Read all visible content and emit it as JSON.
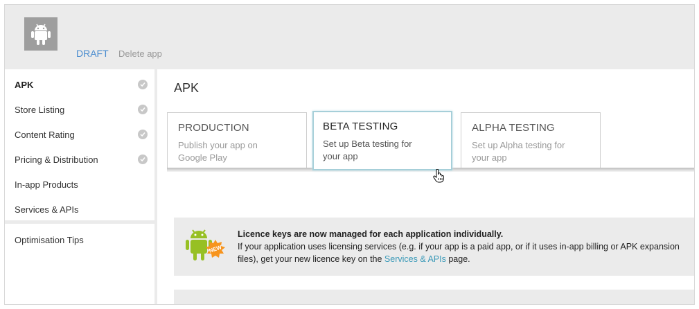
{
  "header": {
    "app_icon": "android-icon",
    "status": "DRAFT",
    "delete_label": "Delete app"
  },
  "sidebar": {
    "items": [
      {
        "label": "APK",
        "active": true,
        "complete": true
      },
      {
        "label": "Store Listing",
        "active": false,
        "complete": true
      },
      {
        "label": "Content Rating",
        "active": false,
        "complete": true
      },
      {
        "label": "Pricing & Distribution",
        "active": false,
        "complete": true
      },
      {
        "label": "In-app Products",
        "active": false,
        "complete": false
      },
      {
        "label": "Services & APIs",
        "active": false,
        "complete": false
      }
    ],
    "extra_items": [
      {
        "label": "Optimisation Tips"
      }
    ],
    "check_icon": "check-circle-icon"
  },
  "main": {
    "title": "APK",
    "tracks": [
      {
        "title": "PRODUCTION",
        "desc": "Publish your app on Google Play",
        "selected": false
      },
      {
        "title": "BETA TESTING",
        "desc": "Set up Beta testing for your app",
        "selected": true
      },
      {
        "title": "ALPHA TESTING",
        "desc": "Set up Alpha testing for your app",
        "selected": false
      }
    ],
    "notice": {
      "icon": "android-new-badge-icon",
      "badge": "NEW",
      "heading": "Licence keys are now managed for each application individually.",
      "body_before": "If your application uses licensing services (e.g. if your app is a paid app, or if it uses in-app billing or APK expansion files), get your new licence key on the ",
      "link": "Services & APIs",
      "body_after": " page."
    }
  },
  "colors": {
    "accent_blue": "#4a8ccf",
    "link_teal": "#3b9ab8",
    "android_green": "#97c024",
    "badge_orange": "#f7941d",
    "panel_gray": "#ebebeb"
  }
}
